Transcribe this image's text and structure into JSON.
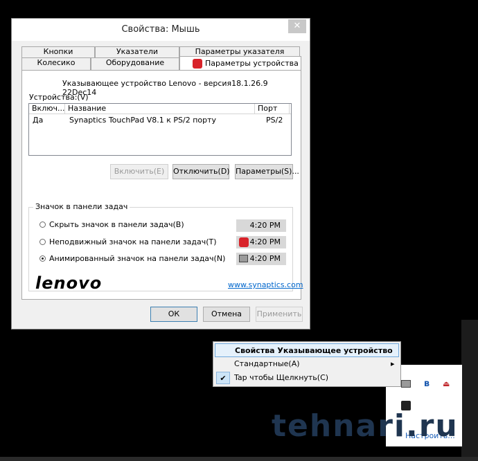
{
  "window": {
    "title": "Свойства: Мышь",
    "close_glyph": "✕"
  },
  "tabs": {
    "row1": [
      "Кнопки",
      "Указатели",
      "Параметры указателя"
    ],
    "row2": [
      "Колесико",
      "Оборудование",
      "Параметры устройства"
    ]
  },
  "panel": {
    "version_text": "Указывающее устройство Lenovo - версия18.1.26.9 22Dec14",
    "devices_label": "Устройства:(V)",
    "columns": [
      "Включ...",
      "Название",
      "Порт"
    ],
    "row": {
      "enabled": "Да",
      "name": "Synaptics TouchPad V8.1 к PS/2 порту",
      "port": "PS/2"
    },
    "enable_button": "Включить(E)",
    "disable_button": "Отключить(D)",
    "settings_button": "Параметры(S)...",
    "group_title": "Значок в панели задач",
    "radios": [
      {
        "label": "Скрыть значок в панели задач(B)",
        "checked": false,
        "time": "4:20 PM"
      },
      {
        "label": "Неподвижный значок на панели задач(T)",
        "checked": false,
        "time": "4:20 PM"
      },
      {
        "label": "Анимированный значок на панели задач(N)",
        "checked": true,
        "time": "4:20 PM"
      }
    ],
    "brand": "lenovo",
    "link": "www.synaptics.com"
  },
  "footer": {
    "ok": "ОК",
    "cancel": "Отмена",
    "apply": "Применить"
  },
  "context_menu": {
    "items": [
      {
        "label": "Свойства Указывающее устройство",
        "highlighted": true
      },
      {
        "label": "Стандартные(A)",
        "submenu_glyph": "▸"
      },
      {
        "label": "Tap чтобы Щелкнуть(C)",
        "checked_glyph": "✔"
      }
    ]
  },
  "tray": {
    "customize": "Настроить..."
  },
  "watermark": "tehnari.ru",
  "colors": {
    "accent_red": "#d8232a",
    "link_blue": "#0066cc",
    "highlight": "#e5f1fb"
  }
}
